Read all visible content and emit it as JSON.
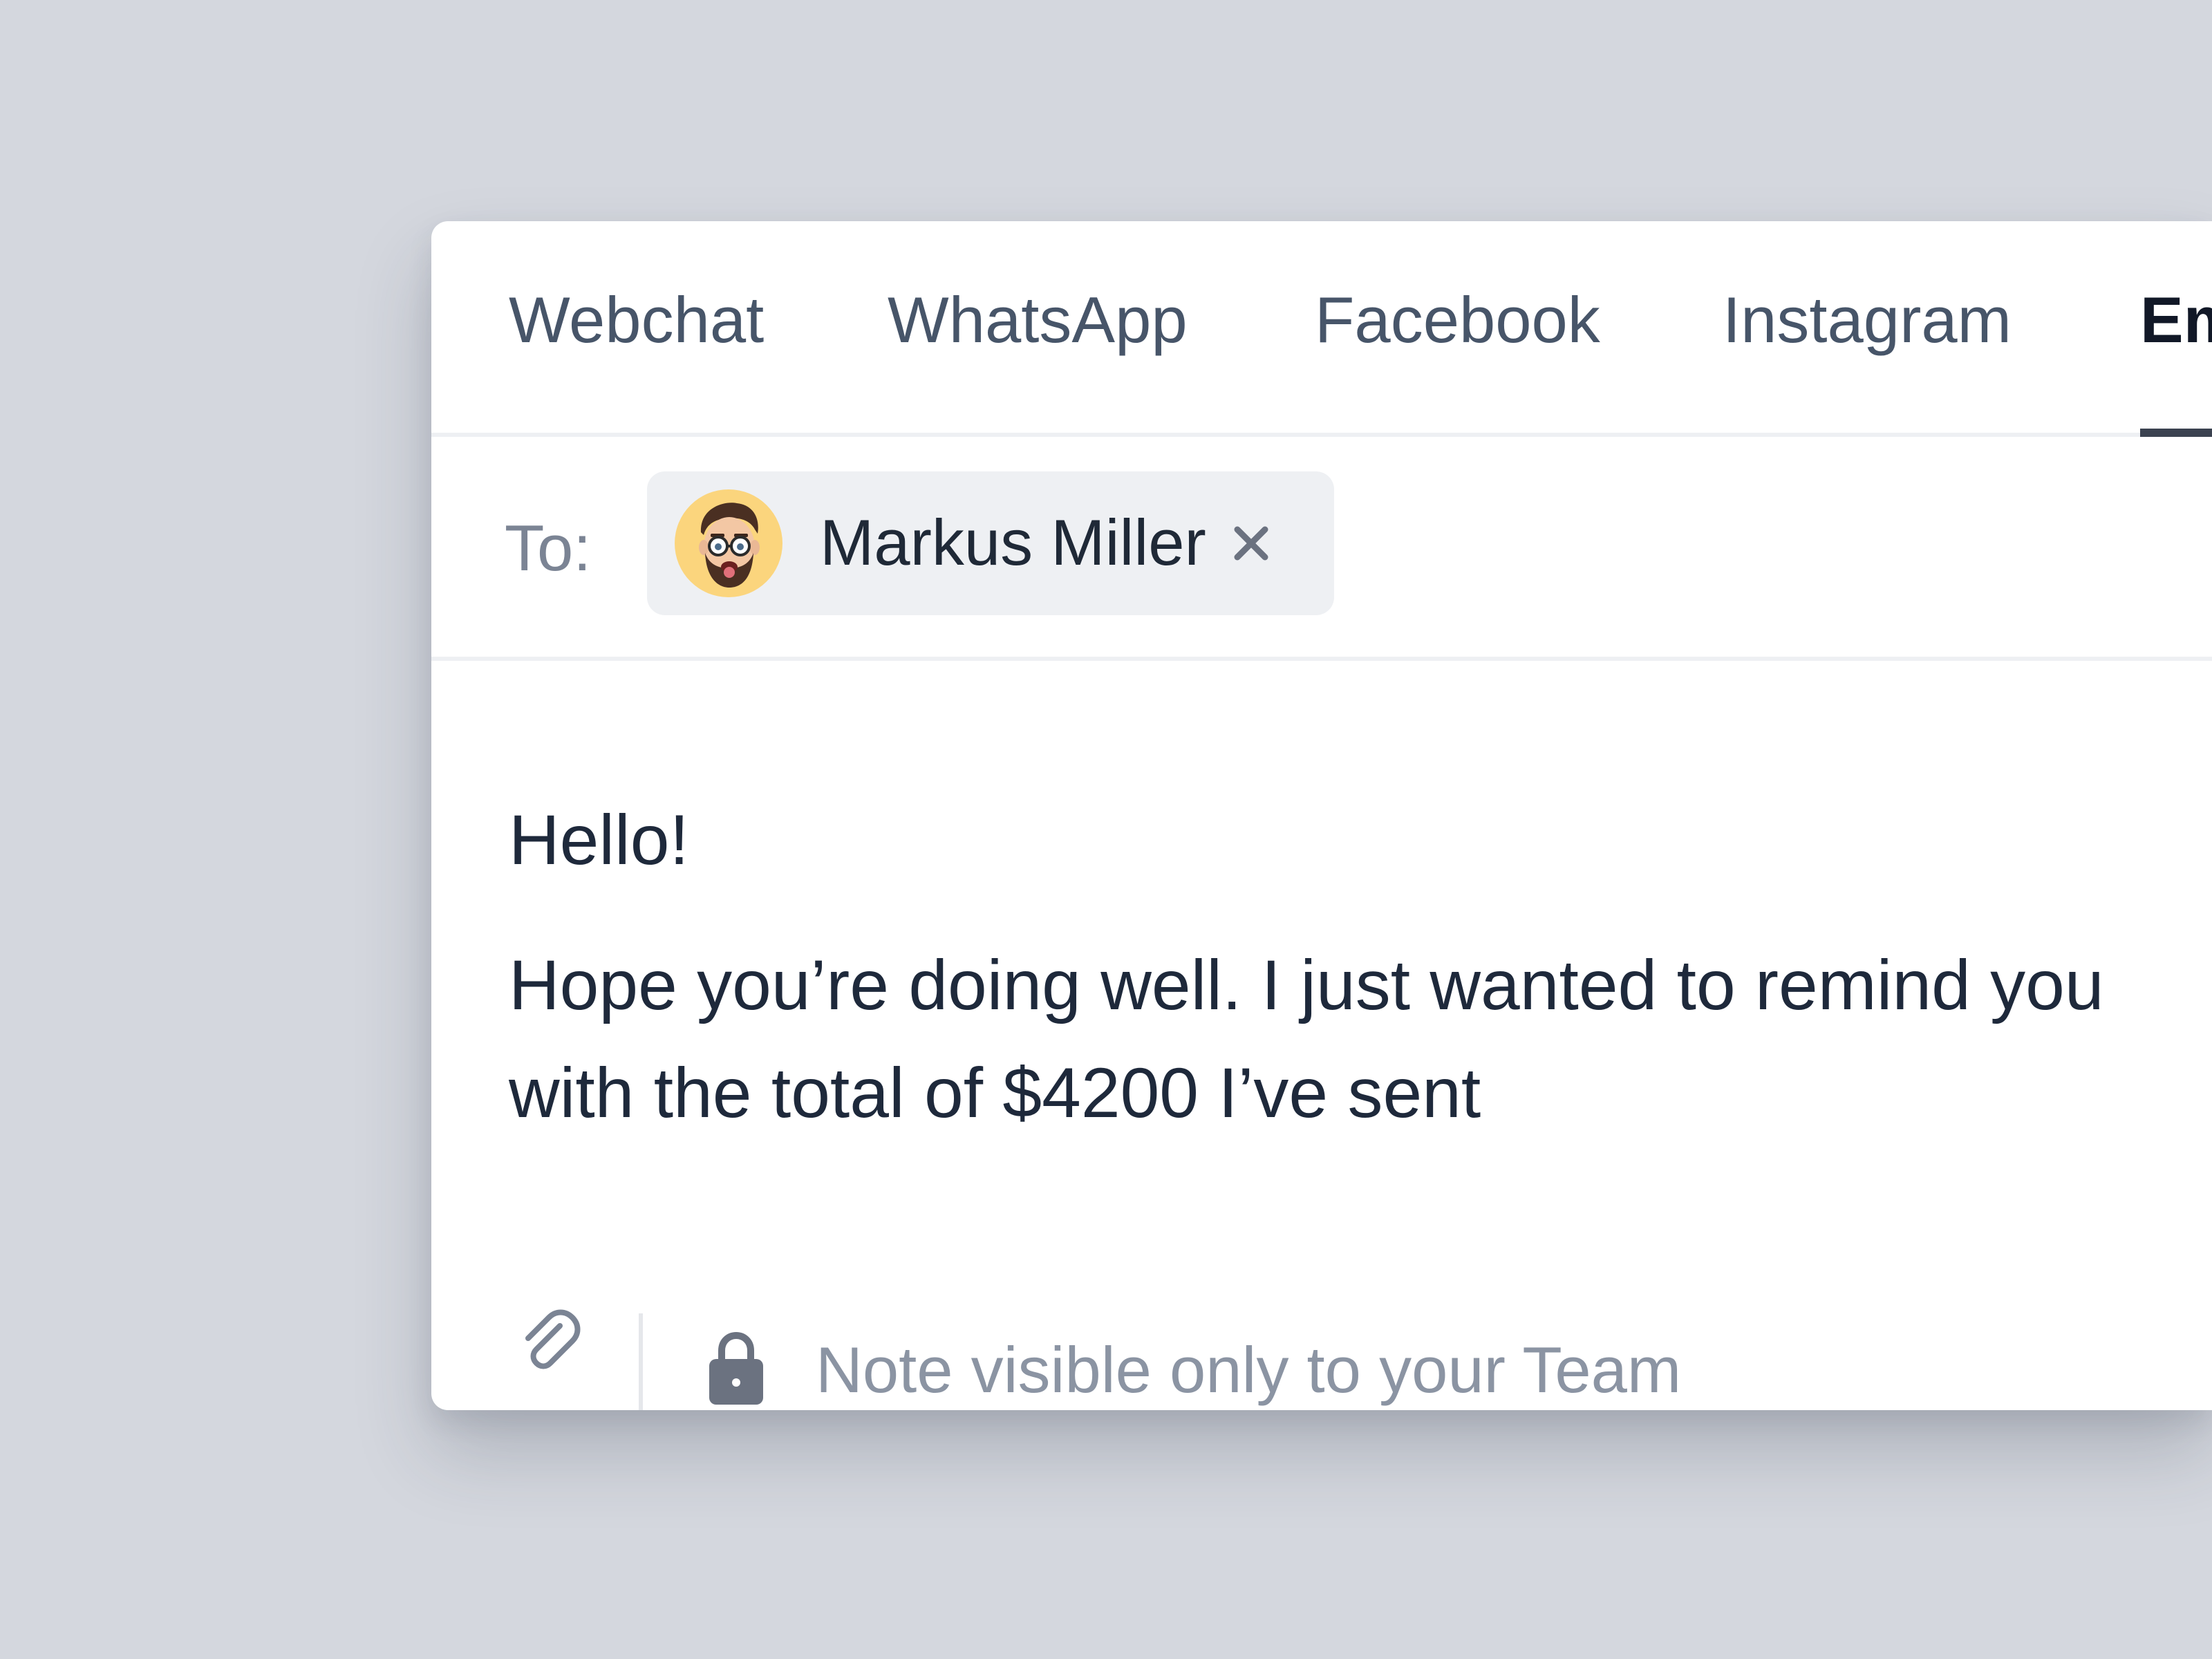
{
  "tabs": [
    {
      "label": "Webchat"
    },
    {
      "label": "WhatsApp"
    },
    {
      "label": "Facebook"
    },
    {
      "label": "Instagram"
    },
    {
      "label": "Em"
    }
  ],
  "active_tab": "Em",
  "recipient": {
    "label": "To:",
    "name": "Markus Miller",
    "avatar_icon": "memoji-avatar",
    "remove_icon": "close-icon"
  },
  "message": {
    "greeting": "Hello!",
    "line1": "Hope you’re doing well. I just wanted to remind you",
    "line2": "with the total of $4200 I’ve sent"
  },
  "footer": {
    "attach_icon": "paperclip-icon",
    "lock_icon": "lock-icon",
    "note_placeholder": "Note visible only to your Team"
  },
  "colors": {
    "background": "#d4d7de",
    "card": "#ffffff",
    "text_primary": "#1e293b",
    "text_muted": "#8b94a3",
    "active_underline": "#3b4250",
    "avatar_bg": "#fbd57d"
  }
}
